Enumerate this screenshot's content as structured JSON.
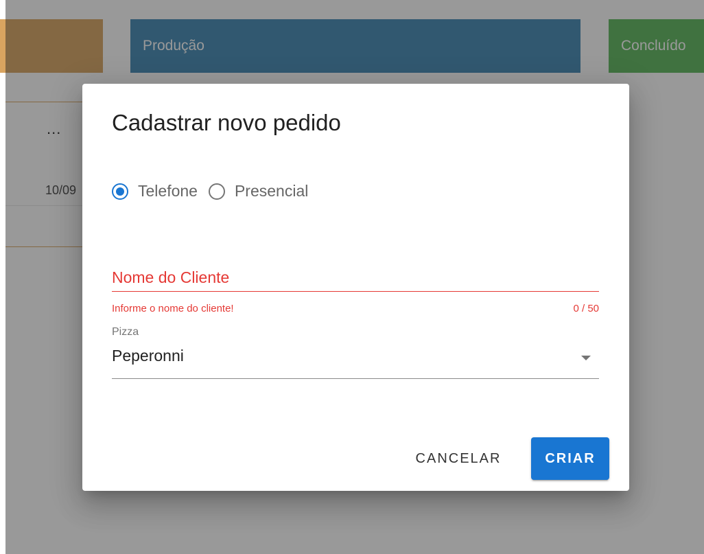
{
  "board": {
    "columns": [
      {
        "label": "",
        "color": "#d9a460"
      },
      {
        "label": "Produção",
        "color": "#3f88b3"
      },
      {
        "label": "Concluído",
        "color": "#5cb85c"
      }
    ],
    "card": {
      "menu": "...",
      "date": "10/09"
    }
  },
  "dialog": {
    "title": "Cadastrar novo pedido",
    "order_type": {
      "options": [
        {
          "label": "Telefone",
          "selected": true
        },
        {
          "label": "Presencial",
          "selected": false
        }
      ]
    },
    "customer_name": {
      "placeholder": "Nome do Cliente",
      "value": "",
      "error": "Informe o nome do cliente!",
      "counter": "0 / 50"
    },
    "pizza": {
      "label": "Pizza",
      "value": "Peperonni"
    },
    "actions": {
      "cancel": "CANCELAR",
      "create": "CRIAR"
    }
  },
  "colors": {
    "primary": "#1976d2",
    "error": "#e53935"
  }
}
